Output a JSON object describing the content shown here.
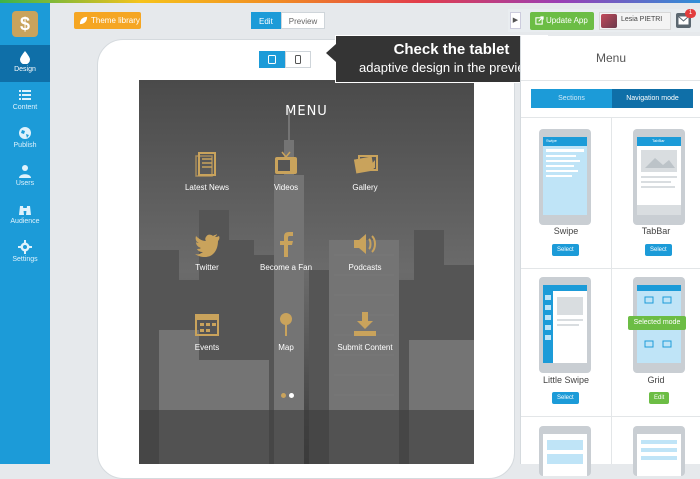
{
  "topbar": {
    "theme_library": "Theme library",
    "edit": "Edit",
    "preview": "Preview",
    "update_app": "Update App",
    "user_name": "Lesia PIETRI",
    "mail_badge": "1"
  },
  "sidebar": {
    "logo": "$",
    "items": [
      {
        "label": "Design",
        "icon": "drop-icon"
      },
      {
        "label": "Content",
        "icon": "list-icon"
      },
      {
        "label": "Publish",
        "icon": "globe-icon"
      },
      {
        "label": "Users",
        "icon": "user-icon"
      },
      {
        "label": "Audience",
        "icon": "binoculars-icon"
      },
      {
        "label": "Settings",
        "icon": "gear-icon"
      }
    ]
  },
  "tooltip": {
    "title": "Check the tablet",
    "subtitle": "adaptive design in the preview"
  },
  "preview": {
    "menu_title": "MENU",
    "tiles": [
      {
        "label": "Latest News",
        "icon": "news-icon"
      },
      {
        "label": "Videos",
        "icon": "tv-icon"
      },
      {
        "label": "Gallery",
        "icon": "photos-icon"
      },
      {
        "label": "Twitter",
        "icon": "twitter-icon"
      },
      {
        "label": "Become a Fan",
        "icon": "facebook-icon"
      },
      {
        "label": "Podcasts",
        "icon": "speaker-icon"
      },
      {
        "label": "Events",
        "icon": "calendar-icon"
      },
      {
        "label": "Map",
        "icon": "pin-icon"
      },
      {
        "label": "Submit Content",
        "icon": "download-icon"
      }
    ],
    "tile_color": "#c9a35c"
  },
  "panel": {
    "title": "Menu",
    "tabs": {
      "sections": "Sections",
      "navigation": "Navigation mode"
    },
    "layouts": [
      {
        "name": "Swipe",
        "action": "Select",
        "thumb_header": "Swipe"
      },
      {
        "name": "TabBar",
        "action": "Select",
        "thumb_header": "TabBar"
      },
      {
        "name": "Little Swipe",
        "action": "Select"
      },
      {
        "name": "Grid",
        "action": "Edit"
      }
    ],
    "selected_badge": "Selected mode"
  },
  "colors": {
    "accent": "#1c9bd8",
    "dark_accent": "#0f6fa8",
    "green": "#6cbd45",
    "orange": "#f5a623"
  }
}
